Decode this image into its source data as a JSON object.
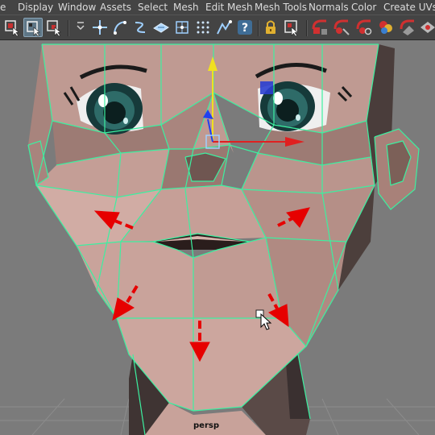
{
  "menubar": {
    "items": [
      {
        "label": "e"
      },
      {
        "label": "Display"
      },
      {
        "label": "Window"
      },
      {
        "label": "Assets"
      },
      {
        "label": "Select"
      },
      {
        "label": "Mesh"
      },
      {
        "label": "Edit Mesh"
      },
      {
        "label": "Mesh Tools"
      },
      {
        "label": "Normals"
      },
      {
        "label": "Color"
      },
      {
        "label": "Create UVs"
      }
    ]
  },
  "toolbar": {
    "active_tool": "select-by-component-icon",
    "icons": [
      "select-by-hierarchy-icon",
      "select-by-component-icon",
      "select-by-object-icon",
      "menu-chevron-icon",
      "snap-to-grids-icon",
      "snap-to-curves-icon",
      "snap-to-points-icon",
      "snap-to-projected-center-icon",
      "snap-to-view-planes-icon",
      "make-live-icon",
      "symmetry-icon",
      "help-icon",
      "lock-icon",
      "input-output-icon",
      "render-icon",
      "ipr-render-icon",
      "render-settings-icon",
      "hypershade-icon",
      "render-setup-icon"
    ]
  },
  "viewport": {
    "camera_label": "persp",
    "colors": {
      "background": "#7b7b7b",
      "grid": "#8c8c8c",
      "skin": "#c8a29a",
      "skin_shadow": "#5a4a47",
      "wireframe": "#3cf0a0",
      "manipulator_x": "#e02020",
      "manipulator_y": "#f0e020",
      "manipulator_z": "#2040f0",
      "annotation_arrow": "#e60000"
    }
  }
}
